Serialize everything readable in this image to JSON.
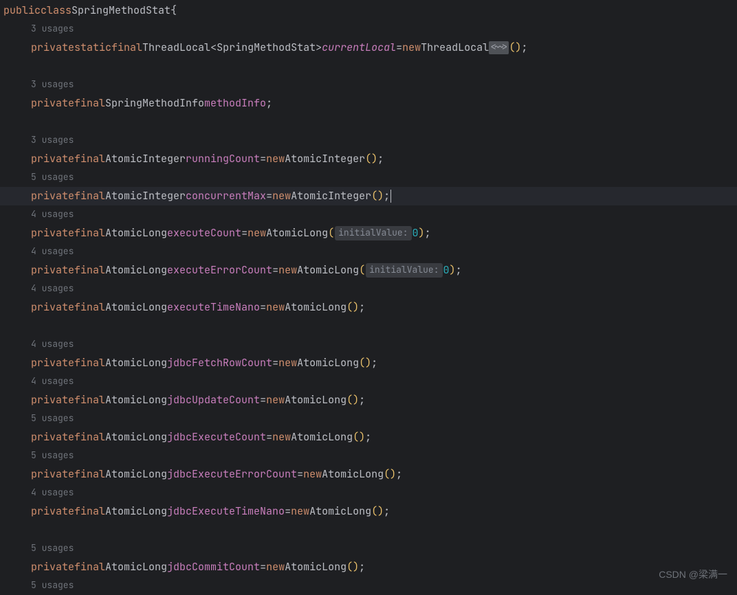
{
  "class": {
    "modifiers": [
      "public",
      "class"
    ],
    "name": "SpringMethodStat",
    "open": "{"
  },
  "fields": [
    {
      "usages": "3 usages",
      "mods": "private static final",
      "type": "ThreadLocal",
      "generic": "SpringMethodStat",
      "name": "currentLocal",
      "eq": "=",
      "new": "new",
      "ctor": "ThreadLocal",
      "genericHint": "<~>",
      "args": "()",
      "semi": ";",
      "nameStatic": true
    },
    {
      "blank": true
    },
    {
      "usages": "3 usages",
      "mods": "private final",
      "type": "SpringMethodInfo",
      "name": "methodInfo",
      "semi": ";"
    },
    {
      "blank": true
    },
    {
      "usages": "3 usages",
      "mods": "private final",
      "type": "AtomicInteger",
      "name": "runningCount",
      "eq": "=",
      "new": "new",
      "ctor": "AtomicInteger",
      "args": "()",
      "semi": ";"
    },
    {
      "usages": "5 usages",
      "mods": "private final",
      "type": "AtomicInteger",
      "name": "concurrentMax",
      "eq": "=",
      "new": "new",
      "ctor": "AtomicInteger",
      "args": "()",
      "semi": ";",
      "highlight": true,
      "caret": true
    },
    {
      "usages": "4 usages",
      "mods": "private final",
      "type": "AtomicLong",
      "name": "executeCount",
      "eq": "=",
      "new": "new",
      "ctor": "AtomicLong",
      "hintLabel": "initialValue:",
      "hintVal": "0",
      "semi": ";"
    },
    {
      "usages": "4 usages",
      "mods": "private final",
      "type": "AtomicLong",
      "name": "executeErrorCount",
      "eq": "=",
      "new": "new",
      "ctor": "AtomicLong",
      "hintLabel": "initialValue:",
      "hintVal": "0",
      "semi": ";"
    },
    {
      "usages": "4 usages",
      "mods": "private final",
      "type": "AtomicLong",
      "name": "executeTimeNano",
      "eq": "=",
      "new": "new",
      "ctor": "AtomicLong",
      "args": "()",
      "semi": ";"
    },
    {
      "blank": true
    },
    {
      "usages": "4 usages",
      "mods": "private final",
      "type": "AtomicLong",
      "name": "jdbcFetchRowCount",
      "eq": "=",
      "new": "new",
      "ctor": "AtomicLong",
      "args": "()",
      "semi": ";"
    },
    {
      "usages": "4 usages",
      "mods": "private final",
      "type": "AtomicLong",
      "name": "jdbcUpdateCount",
      "eq": "=",
      "new": "new",
      "ctor": "AtomicLong",
      "args": "()",
      "semi": ";"
    },
    {
      "usages": "5 usages",
      "mods": "private final",
      "type": "AtomicLong",
      "name": "jdbcExecuteCount",
      "eq": "=",
      "new": "new",
      "ctor": "AtomicLong",
      "args": "()",
      "semi": ";"
    },
    {
      "usages": "5 usages",
      "mods": "private final",
      "type": "AtomicLong",
      "name": "jdbcExecuteErrorCount",
      "eq": "=",
      "new": "new",
      "ctor": "AtomicLong",
      "args": "()",
      "semi": ";"
    },
    {
      "usages": "4 usages",
      "mods": "private final",
      "type": "AtomicLong",
      "name": "jdbcExecuteTimeNano",
      "eq": "=",
      "new": "new",
      "ctor": "AtomicLong",
      "args": "()",
      "semi": ";"
    },
    {
      "blank": true
    },
    {
      "usages": "5 usages",
      "mods": "private final",
      "type": "AtomicLong",
      "name": "jdbcCommitCount",
      "eq": "=",
      "new": "new",
      "ctor": "AtomicLong",
      "args": "()",
      "semi": ";"
    },
    {
      "usages": "5 usages"
    }
  ],
  "watermark": "CSDN @梁满一"
}
